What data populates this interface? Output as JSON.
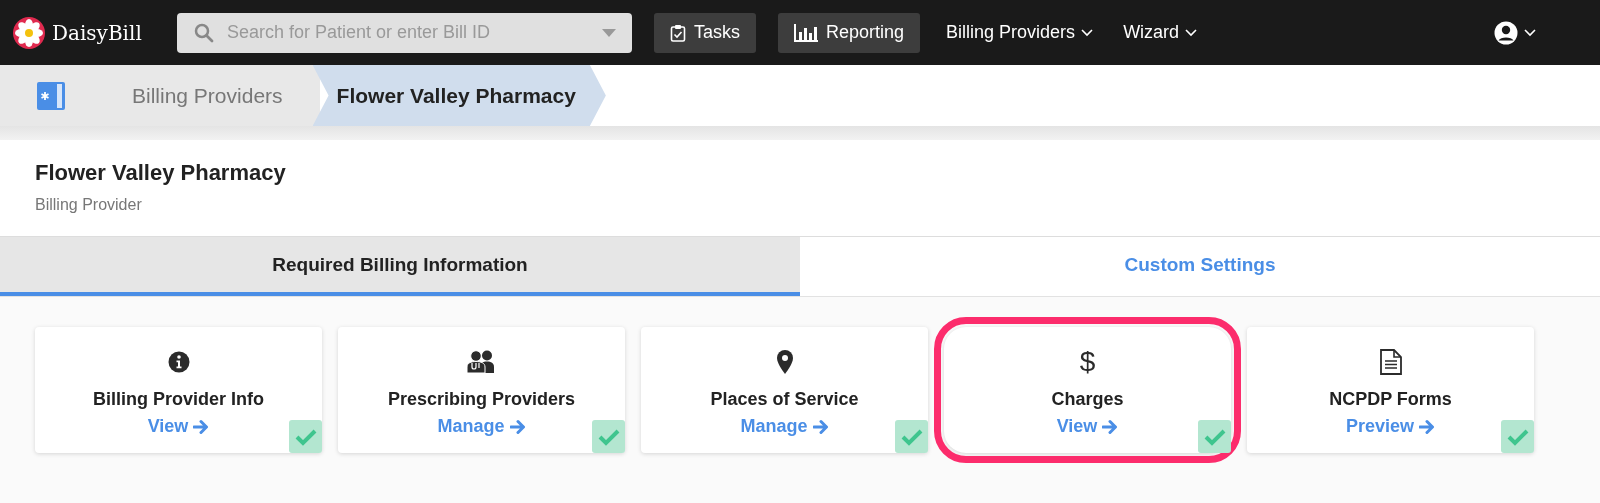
{
  "brand": {
    "name": "DaisyBill"
  },
  "search": {
    "placeholder": "Search for Patient or enter Bill ID"
  },
  "nav": [
    {
      "label": "Tasks",
      "kind": "button"
    },
    {
      "label": "Reporting",
      "kind": "button"
    },
    {
      "label": "Billing Providers",
      "kind": "menu"
    },
    {
      "label": "Wizard",
      "kind": "menu"
    }
  ],
  "breadcrumb": [
    {
      "label": "Billing Providers",
      "selected": false
    },
    {
      "label": "Flower Valley Pharmacy",
      "selected": true
    }
  ],
  "header": {
    "title": "Flower Valley Pharmacy",
    "subtitle": "Billing Provider"
  },
  "tabs": [
    {
      "label": "Required Billing Information",
      "selected": true
    },
    {
      "label": "Custom Settings",
      "selected": false
    }
  ],
  "cards": [
    {
      "title": "Billing Provider Info",
      "link": "View",
      "complete": true,
      "highlighted": false
    },
    {
      "title": "Prescribing Providers",
      "link": "Manage",
      "complete": true,
      "highlighted": false
    },
    {
      "title": "Places of Service",
      "link": "Manage",
      "complete": true,
      "highlighted": false
    },
    {
      "symbol": "$",
      "title": "Charges",
      "link": "View",
      "complete": true,
      "highlighted": true
    },
    {
      "title": "NCPDP Forms",
      "link": "Preview",
      "complete": true,
      "highlighted": false
    }
  ]
}
